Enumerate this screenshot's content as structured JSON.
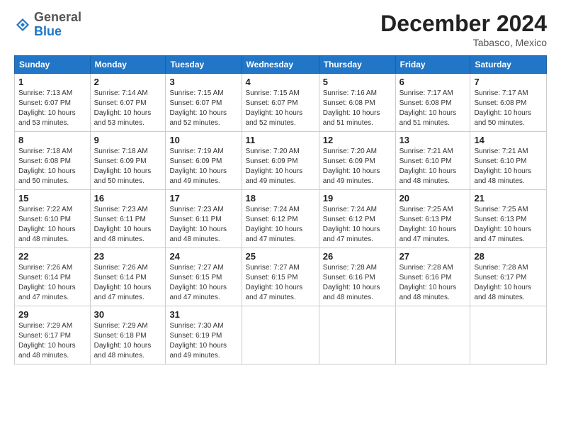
{
  "logo": {
    "general": "General",
    "blue": "Blue"
  },
  "header": {
    "month": "December 2024",
    "location": "Tabasco, Mexico"
  },
  "weekdays": [
    "Sunday",
    "Monday",
    "Tuesday",
    "Wednesday",
    "Thursday",
    "Friday",
    "Saturday"
  ],
  "weeks": [
    [
      {
        "day": "1",
        "info": "Sunrise: 7:13 AM\nSunset: 6:07 PM\nDaylight: 10 hours\nand 53 minutes."
      },
      {
        "day": "2",
        "info": "Sunrise: 7:14 AM\nSunset: 6:07 PM\nDaylight: 10 hours\nand 53 minutes."
      },
      {
        "day": "3",
        "info": "Sunrise: 7:15 AM\nSunset: 6:07 PM\nDaylight: 10 hours\nand 52 minutes."
      },
      {
        "day": "4",
        "info": "Sunrise: 7:15 AM\nSunset: 6:07 PM\nDaylight: 10 hours\nand 52 minutes."
      },
      {
        "day": "5",
        "info": "Sunrise: 7:16 AM\nSunset: 6:08 PM\nDaylight: 10 hours\nand 51 minutes."
      },
      {
        "day": "6",
        "info": "Sunrise: 7:17 AM\nSunset: 6:08 PM\nDaylight: 10 hours\nand 51 minutes."
      },
      {
        "day": "7",
        "info": "Sunrise: 7:17 AM\nSunset: 6:08 PM\nDaylight: 10 hours\nand 50 minutes."
      }
    ],
    [
      {
        "day": "8",
        "info": "Sunrise: 7:18 AM\nSunset: 6:08 PM\nDaylight: 10 hours\nand 50 minutes."
      },
      {
        "day": "9",
        "info": "Sunrise: 7:18 AM\nSunset: 6:09 PM\nDaylight: 10 hours\nand 50 minutes."
      },
      {
        "day": "10",
        "info": "Sunrise: 7:19 AM\nSunset: 6:09 PM\nDaylight: 10 hours\nand 49 minutes."
      },
      {
        "day": "11",
        "info": "Sunrise: 7:20 AM\nSunset: 6:09 PM\nDaylight: 10 hours\nand 49 minutes."
      },
      {
        "day": "12",
        "info": "Sunrise: 7:20 AM\nSunset: 6:09 PM\nDaylight: 10 hours\nand 49 minutes."
      },
      {
        "day": "13",
        "info": "Sunrise: 7:21 AM\nSunset: 6:10 PM\nDaylight: 10 hours\nand 48 minutes."
      },
      {
        "day": "14",
        "info": "Sunrise: 7:21 AM\nSunset: 6:10 PM\nDaylight: 10 hours\nand 48 minutes."
      }
    ],
    [
      {
        "day": "15",
        "info": "Sunrise: 7:22 AM\nSunset: 6:10 PM\nDaylight: 10 hours\nand 48 minutes."
      },
      {
        "day": "16",
        "info": "Sunrise: 7:23 AM\nSunset: 6:11 PM\nDaylight: 10 hours\nand 48 minutes."
      },
      {
        "day": "17",
        "info": "Sunrise: 7:23 AM\nSunset: 6:11 PM\nDaylight: 10 hours\nand 48 minutes."
      },
      {
        "day": "18",
        "info": "Sunrise: 7:24 AM\nSunset: 6:12 PM\nDaylight: 10 hours\nand 47 minutes."
      },
      {
        "day": "19",
        "info": "Sunrise: 7:24 AM\nSunset: 6:12 PM\nDaylight: 10 hours\nand 47 minutes."
      },
      {
        "day": "20",
        "info": "Sunrise: 7:25 AM\nSunset: 6:13 PM\nDaylight: 10 hours\nand 47 minutes."
      },
      {
        "day": "21",
        "info": "Sunrise: 7:25 AM\nSunset: 6:13 PM\nDaylight: 10 hours\nand 47 minutes."
      }
    ],
    [
      {
        "day": "22",
        "info": "Sunrise: 7:26 AM\nSunset: 6:14 PM\nDaylight: 10 hours\nand 47 minutes."
      },
      {
        "day": "23",
        "info": "Sunrise: 7:26 AM\nSunset: 6:14 PM\nDaylight: 10 hours\nand 47 minutes."
      },
      {
        "day": "24",
        "info": "Sunrise: 7:27 AM\nSunset: 6:15 PM\nDaylight: 10 hours\nand 47 minutes."
      },
      {
        "day": "25",
        "info": "Sunrise: 7:27 AM\nSunset: 6:15 PM\nDaylight: 10 hours\nand 47 minutes."
      },
      {
        "day": "26",
        "info": "Sunrise: 7:28 AM\nSunset: 6:16 PM\nDaylight: 10 hours\nand 48 minutes."
      },
      {
        "day": "27",
        "info": "Sunrise: 7:28 AM\nSunset: 6:16 PM\nDaylight: 10 hours\nand 48 minutes."
      },
      {
        "day": "28",
        "info": "Sunrise: 7:28 AM\nSunset: 6:17 PM\nDaylight: 10 hours\nand 48 minutes."
      }
    ],
    [
      {
        "day": "29",
        "info": "Sunrise: 7:29 AM\nSunset: 6:17 PM\nDaylight: 10 hours\nand 48 minutes."
      },
      {
        "day": "30",
        "info": "Sunrise: 7:29 AM\nSunset: 6:18 PM\nDaylight: 10 hours\nand 48 minutes."
      },
      {
        "day": "31",
        "info": "Sunrise: 7:30 AM\nSunset: 6:19 PM\nDaylight: 10 hours\nand 49 minutes."
      },
      null,
      null,
      null,
      null
    ]
  ]
}
